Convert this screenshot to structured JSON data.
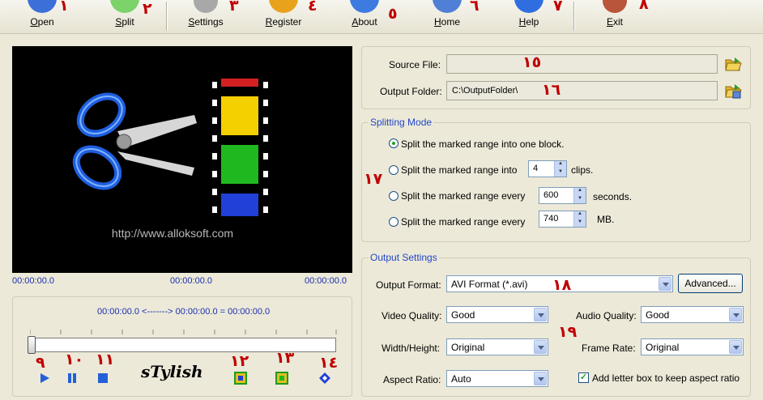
{
  "toolbar": {
    "items": [
      {
        "label": "Open",
        "num": "١",
        "color": "#3d6fd9"
      },
      {
        "label": "Split",
        "num": "٢",
        "color": "#7bd36a"
      },
      {
        "label": "Settings",
        "num": "٣",
        "color": "#8a8a8a"
      },
      {
        "label": "Register",
        "num": "٤",
        "color": "#e8a21c"
      },
      {
        "label": "About",
        "num": "٥",
        "color": "#3d7be0"
      },
      {
        "label": "Home",
        "num": "٦",
        "color": "#4f7fd6"
      },
      {
        "label": "Help",
        "num": "٧",
        "color": "#2f6ee0"
      },
      {
        "label": "Exit",
        "num": "٨",
        "color": "#b9553a"
      }
    ]
  },
  "preview": {
    "url": "http://www.alloksoft.com",
    "time_left": "00:00:00.0",
    "time_mid": "00:00:00.0",
    "time_right": "00:00:00.0"
  },
  "range": {
    "text": "00:00:00.0 <-------> 00:00:00.0 =  00:00:00.0"
  },
  "controls": {
    "skin_label": "sTylish",
    "play_num": "٩",
    "pause_num": "١٠",
    "stop_num": "١١",
    "mark_in_num": "١٢",
    "mark_out_num": "١٣",
    "goto_num": "١٤"
  },
  "files": {
    "source_label": "Source File:",
    "source_value": "",
    "source_num": "١٥",
    "output_label": "Output Folder:",
    "output_value": "C:\\OutputFolder\\",
    "output_num": "١٦"
  },
  "splitting": {
    "legend": "Splitting Mode",
    "num": "١٧",
    "opt1": "Split the marked range into one block.",
    "opt2": "Split the marked range into",
    "opt2_value": "4",
    "opt2_unit": "clips.",
    "opt3": "Split the marked range every",
    "opt3_value": "600",
    "opt3_unit": "seconds.",
    "opt4": "Split the marked range every",
    "opt4_value": "740",
    "opt4_unit": "MB."
  },
  "output": {
    "legend": "Output Settings",
    "format_label": "Output Format:",
    "format_value": "AVI Format (*.avi)",
    "format_num": "١٨",
    "advanced_label": "Advanced...",
    "settings_num": "١٩",
    "video_quality_label": "Video Quality:",
    "video_quality_value": "Good",
    "audio_quality_label": "Audio Quality:",
    "audio_quality_value": "Good",
    "width_height_label": "Width/Height:",
    "width_height_value": "Original",
    "frame_rate_label": "Frame Rate:",
    "frame_rate_value": "Original",
    "aspect_label": "Aspect Ratio:",
    "aspect_value": "Auto",
    "letterbox_label": "Add letter box to keep aspect ratio",
    "letterbox_checked": "✓"
  }
}
